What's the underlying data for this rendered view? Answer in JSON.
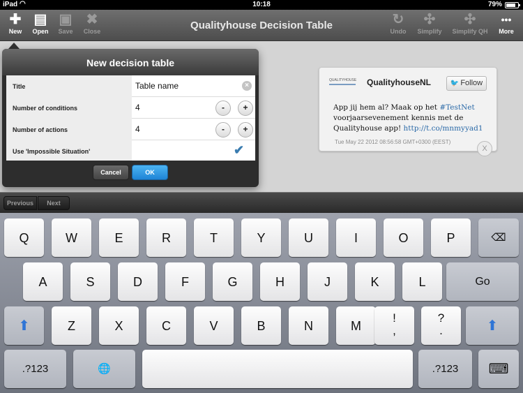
{
  "status_bar": {
    "carrier": "iPad",
    "time": "10:18",
    "battery": "79%",
    "battery_level": 0.79
  },
  "toolbar": {
    "title": "Qualityhouse Decision Table",
    "left_buttons": [
      {
        "label": "New",
        "icon": "plus-icon",
        "glyph": "✚"
      },
      {
        "label": "Open",
        "icon": "open-icon",
        "glyph": "▤"
      },
      {
        "label": "Save",
        "icon": "save-icon",
        "glyph": "▣"
      },
      {
        "label": "Close",
        "icon": "close-icon",
        "glyph": "✖"
      }
    ],
    "right_buttons": [
      {
        "label": "Undo",
        "icon": "undo-icon",
        "glyph": "↻"
      },
      {
        "label": "Simplify",
        "icon": "simplify-icon",
        "glyph": "✣"
      },
      {
        "label": "Simplify QH",
        "icon": "simplify-qh-icon",
        "glyph": "✣"
      },
      {
        "label": "More",
        "icon": "more-icon",
        "glyph": "•••"
      }
    ]
  },
  "dialog": {
    "title": "New decision table",
    "rows": {
      "title": {
        "label": "Title",
        "value": "Table name"
      },
      "conditions": {
        "label": "Number of conditions",
        "value": "4",
        "minus": "-",
        "plus": "+"
      },
      "actions": {
        "label": "Number of actions",
        "value": "4",
        "minus": "-",
        "plus": "+"
      },
      "impossible": {
        "label": "Use 'Impossible Situation'",
        "checked": true,
        "check": "✔"
      }
    },
    "cancel_label": "Cancel",
    "ok_label": "OK"
  },
  "tweet": {
    "logo_text": "QUALITYHOUSE",
    "account": "QualityhouseNL",
    "follow_label": "Follow",
    "text_before": "App jij hem al? Maak op het ",
    "hashtag": "#TestNet",
    "text_middle": " voorjaarsevenement kennis met de Qualityhouse app! ",
    "link": "http://t.co/mnmyyad1",
    "date": "Tue May 22 2012 08:56:58 GMT+0300 (EEST)",
    "close": "X"
  },
  "input_bar": {
    "previous": "Previous",
    "next": "Next"
  },
  "keyboard": {
    "row1": [
      "Q",
      "W",
      "E",
      "R",
      "T",
      "Y",
      "U",
      "I",
      "O",
      "P"
    ],
    "row2": [
      "A",
      "S",
      "D",
      "F",
      "G",
      "H",
      "J",
      "K",
      "L"
    ],
    "row3": [
      "Z",
      "X",
      "C",
      "V",
      "B",
      "N",
      "M"
    ],
    "go": "Go",
    "exclaim": [
      "!",
      ","
    ],
    "question": [
      "?",
      "."
    ],
    "numbers": ".?123",
    "backspace": "⌫",
    "shift": "⬆",
    "globe": "🌐",
    "hide": "⌨"
  },
  "colors": {
    "accent": "#1e84d6",
    "check": "#3a7cb0",
    "twitter_link": "#2b6aa8"
  }
}
